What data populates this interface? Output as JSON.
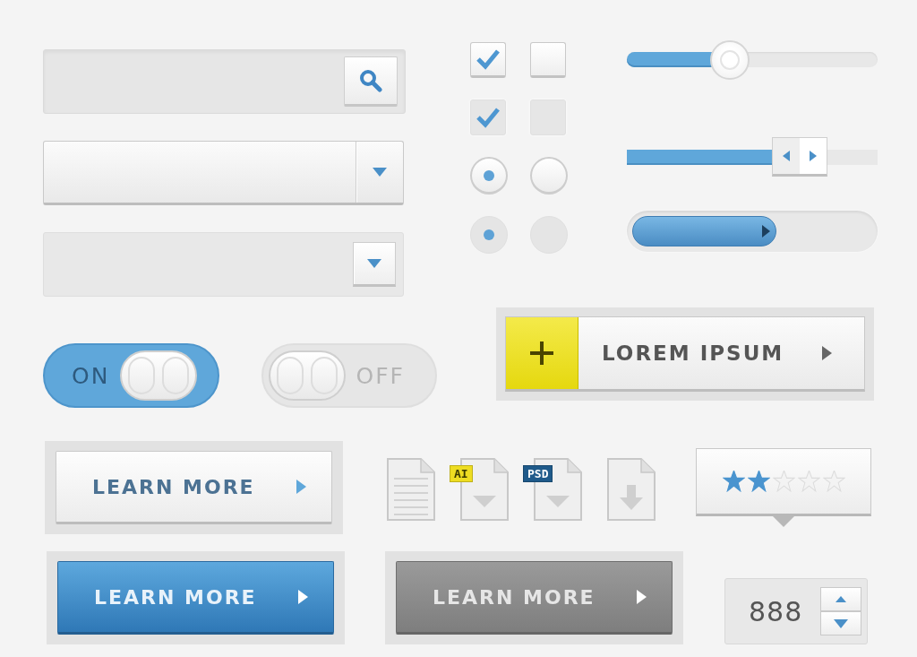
{
  "fields": [
    {
      "kind": "search"
    },
    {
      "kind": "dropdown",
      "disabled": false
    },
    {
      "kind": "dropdown",
      "disabled": true
    }
  ],
  "checkboxes": [
    {
      "checked": true,
      "disabled": false
    },
    {
      "checked": false,
      "disabled": false
    },
    {
      "checked": true,
      "disabled": true
    },
    {
      "checked": false,
      "disabled": true
    }
  ],
  "radios": [
    {
      "selected": true,
      "disabled": false
    },
    {
      "selected": false,
      "disabled": false
    },
    {
      "selected": true,
      "disabled": true
    },
    {
      "selected": false,
      "disabled": true
    }
  ],
  "sliders": [
    {
      "kind": "round",
      "level": 0.41
    },
    {
      "kind": "arrows",
      "level": 0.58
    },
    {
      "kind": "progress",
      "level": 0.6
    }
  ],
  "toggles": [
    {
      "label": "ON",
      "on": true
    },
    {
      "label": "OFF",
      "on": false
    }
  ],
  "add_button": {
    "label": "LOREM IPSUM"
  },
  "buttons": [
    {
      "label": "LEARN MORE",
      "kind": "light"
    },
    {
      "label": "LEARN MORE",
      "kind": "primary"
    },
    {
      "label": "LEARN MORE",
      "kind": "dark"
    }
  ],
  "files": [
    {
      "kind": "text"
    },
    {
      "kind": "tagged",
      "tag": "AI",
      "color": "#eedd22"
    },
    {
      "kind": "tagged",
      "tag": "PSD",
      "color": "#1f5a8a"
    },
    {
      "kind": "download"
    }
  ],
  "rating": {
    "stars": 2
  },
  "spinner": {
    "value": "888"
  }
}
